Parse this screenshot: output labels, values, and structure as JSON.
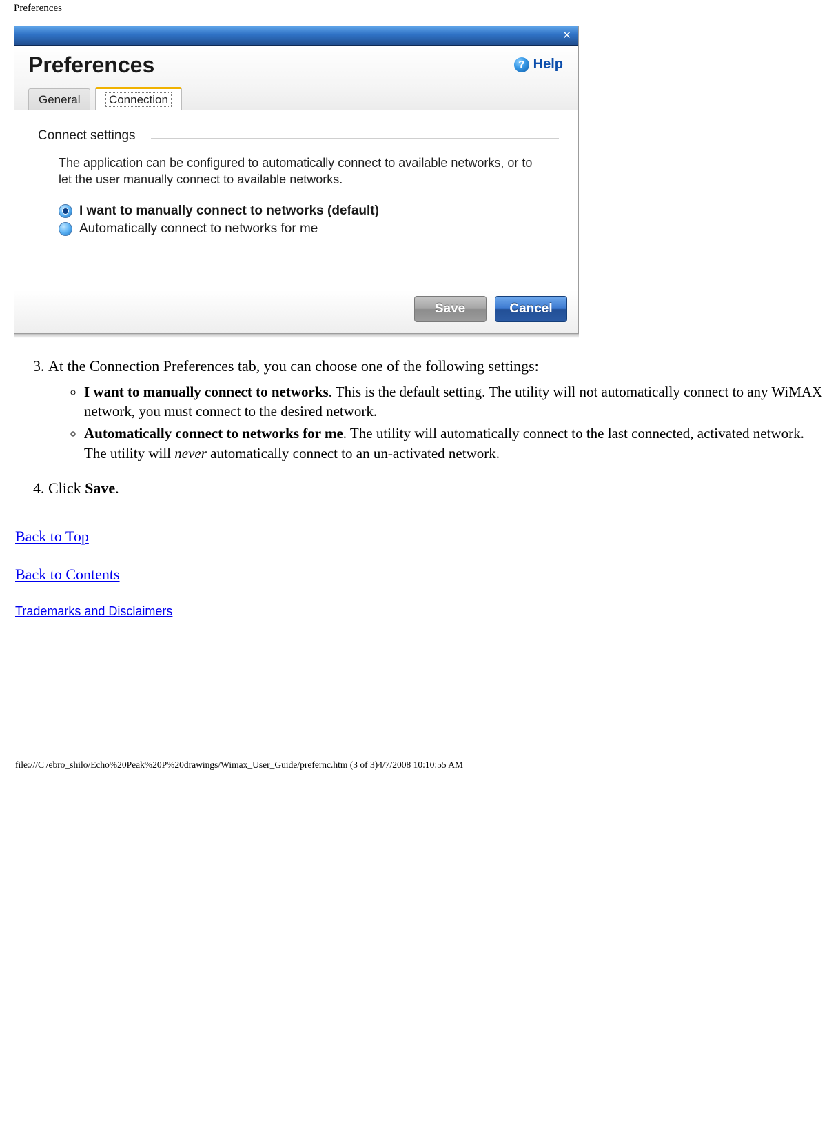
{
  "page_header": "Preferences",
  "dialog": {
    "title": "Preferences",
    "help_label": "Help",
    "tabs": {
      "general": "General",
      "connection": "Connection"
    },
    "fieldset_legend": "Connect settings",
    "description": "The application can be configured to automatically connect to available networks, or to let the user manually connect to available networks.",
    "option_manual": "I want to manually connect to networks (default)",
    "option_auto": "Automatically connect to networks for me",
    "save_label": "Save",
    "cancel_label": "Cancel"
  },
  "doc": {
    "step3_intro": "At the Connection Preferences tab, you can choose one of the following settings:",
    "step3_bullet1_bold": "I want to manually connect to networks",
    "step3_bullet1_rest": ". This is the default setting. The utility will not automatically connect to any WiMAX network, you must connect to the desired network.",
    "step3_bullet2_bold": "Automatically connect to networks for me",
    "step3_bullet2_rest_a": ". The utility will automatically connect to the last connected, activated network. The utility will ",
    "step3_bullet2_emph": "never",
    "step3_bullet2_rest_b": " automatically connect to an un-activated network.",
    "step4_a": "Click ",
    "step4_bold": "Save",
    "step4_b": ".",
    "link_top": "Back to Top",
    "link_contents": "Back to Contents",
    "link_trademarks": "Trademarks and Disclaimers",
    "footer": "file:///C|/ebro_shilo/Echo%20Peak%20P%20drawings/Wimax_User_Guide/prefernc.htm (3 of 3)4/7/2008 10:10:55 AM"
  }
}
